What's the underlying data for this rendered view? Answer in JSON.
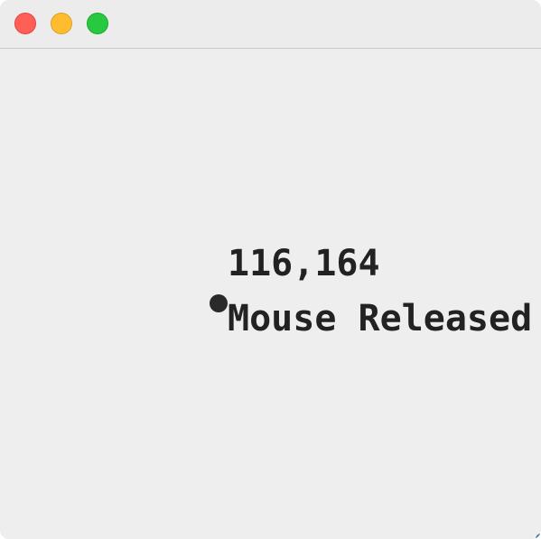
{
  "window": {
    "controls": {
      "close": "close-icon",
      "minimize": "minimize-icon",
      "maximize": "maximize-icon"
    }
  },
  "canvas": {
    "coordinates_text": "116,164",
    "event_text": "Mouse Released"
  },
  "colors": {
    "close": "#ff5f57",
    "minimize": "#febc2e",
    "maximize": "#28c840",
    "background": "#eeeeee",
    "text": "#222222",
    "marker": "#2a2a2a"
  }
}
